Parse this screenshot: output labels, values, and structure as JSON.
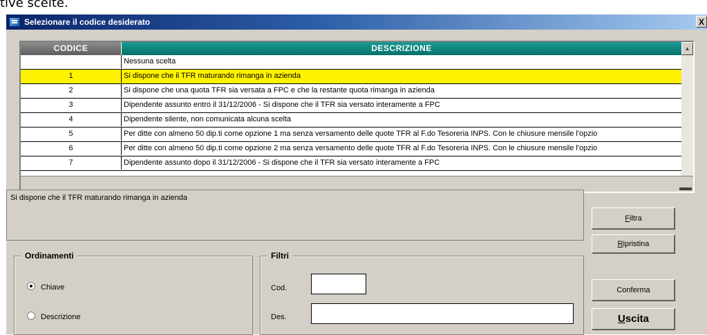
{
  "background_text": "tive scelte.",
  "window": {
    "title": "Selezionare il codice desiderato",
    "close_label": "X"
  },
  "grid": {
    "headers": {
      "codice": "CODICE",
      "descrizione": "DESCRIZIONE"
    },
    "rows": [
      {
        "code": "",
        "desc": "Nessuna scelta"
      },
      {
        "code": "1",
        "desc": "Si dispone che il TFR maturando rimanga in azienda",
        "selected": true
      },
      {
        "code": "2",
        "desc": "Si dispone che una quota TFR sia versata a FPC e che la restante quota rimanga in azienda"
      },
      {
        "code": "3",
        "desc": "Dipendente assunto entro il 31/12/2006 - Si dispone che il TFR sia versato interamente a FPC"
      },
      {
        "code": "4",
        "desc": "Dipendente silente, non comunicata alcuna scelta"
      },
      {
        "code": "5",
        "desc": "Per ditte con almeno 50 dip.ti  come opzione 1 ma senza versamento delle quote TFR al F.do Tesoreria INPS. Con le chiusure mensile l'opzio"
      },
      {
        "code": "6",
        "desc": "Per ditte con almeno 50 dip.ti  come opzione 2 ma senza versamento delle quote TFR al F.do Tesoreria INPS. Con le chiusure mensile l'opzio"
      },
      {
        "code": "7",
        "desc": "Dipendente assunto dopo il 31/12/2006 - Si dispone che il TFR sia versato interamente a FPC"
      }
    ],
    "colors": {
      "selected_row": "#fff200",
      "desc_header": "#0a7f79",
      "code_header": "#707070"
    }
  },
  "description_text": "Si dispone che il TFR maturando rimanga in azienda",
  "ordinamenti": {
    "legend": "Ordinamenti",
    "options": [
      {
        "label": "Chiave",
        "checked": true
      },
      {
        "label": "Descrizione",
        "checked": false
      }
    ]
  },
  "filtri": {
    "legend": "Filtri",
    "cod_label": "Cod.",
    "cod_value": "",
    "des_label": "Des.",
    "des_value": ""
  },
  "buttons": {
    "filtra_u": "F",
    "filtra_rest": "iltra",
    "ripristina_u": "R",
    "ripristina_rest": "ipristina",
    "conferma": "Conferma",
    "uscita_u": "U",
    "uscita_rest": "scita"
  }
}
